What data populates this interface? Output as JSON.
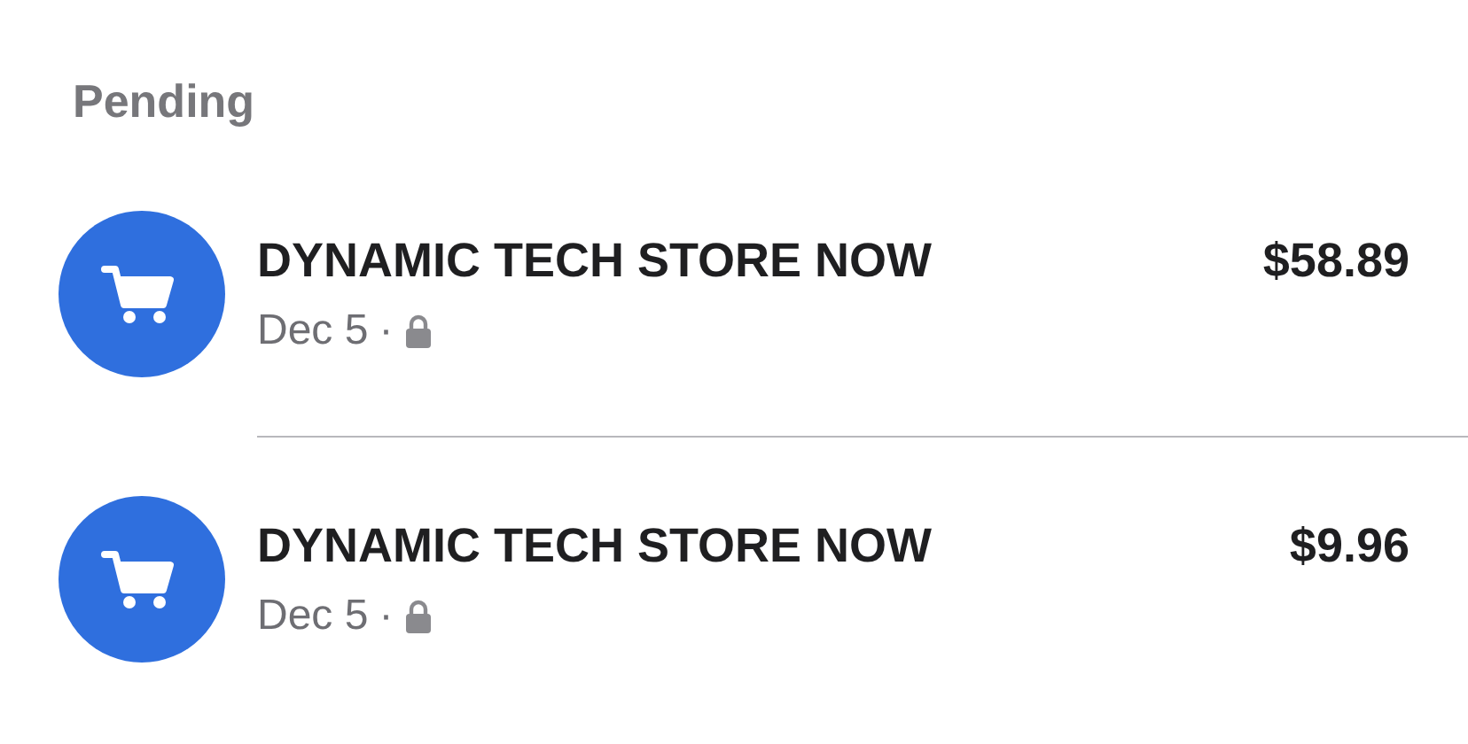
{
  "section_title": "Pending",
  "transactions": [
    {
      "merchant": "DYNAMIC TECH STORE NOW",
      "amount": "$58.89",
      "date": "Dec 5",
      "separator": "·"
    },
    {
      "merchant": "DYNAMIC TECH STORE NOW",
      "amount": "$9.96",
      "date": "Dec 5",
      "separator": "·"
    }
  ]
}
